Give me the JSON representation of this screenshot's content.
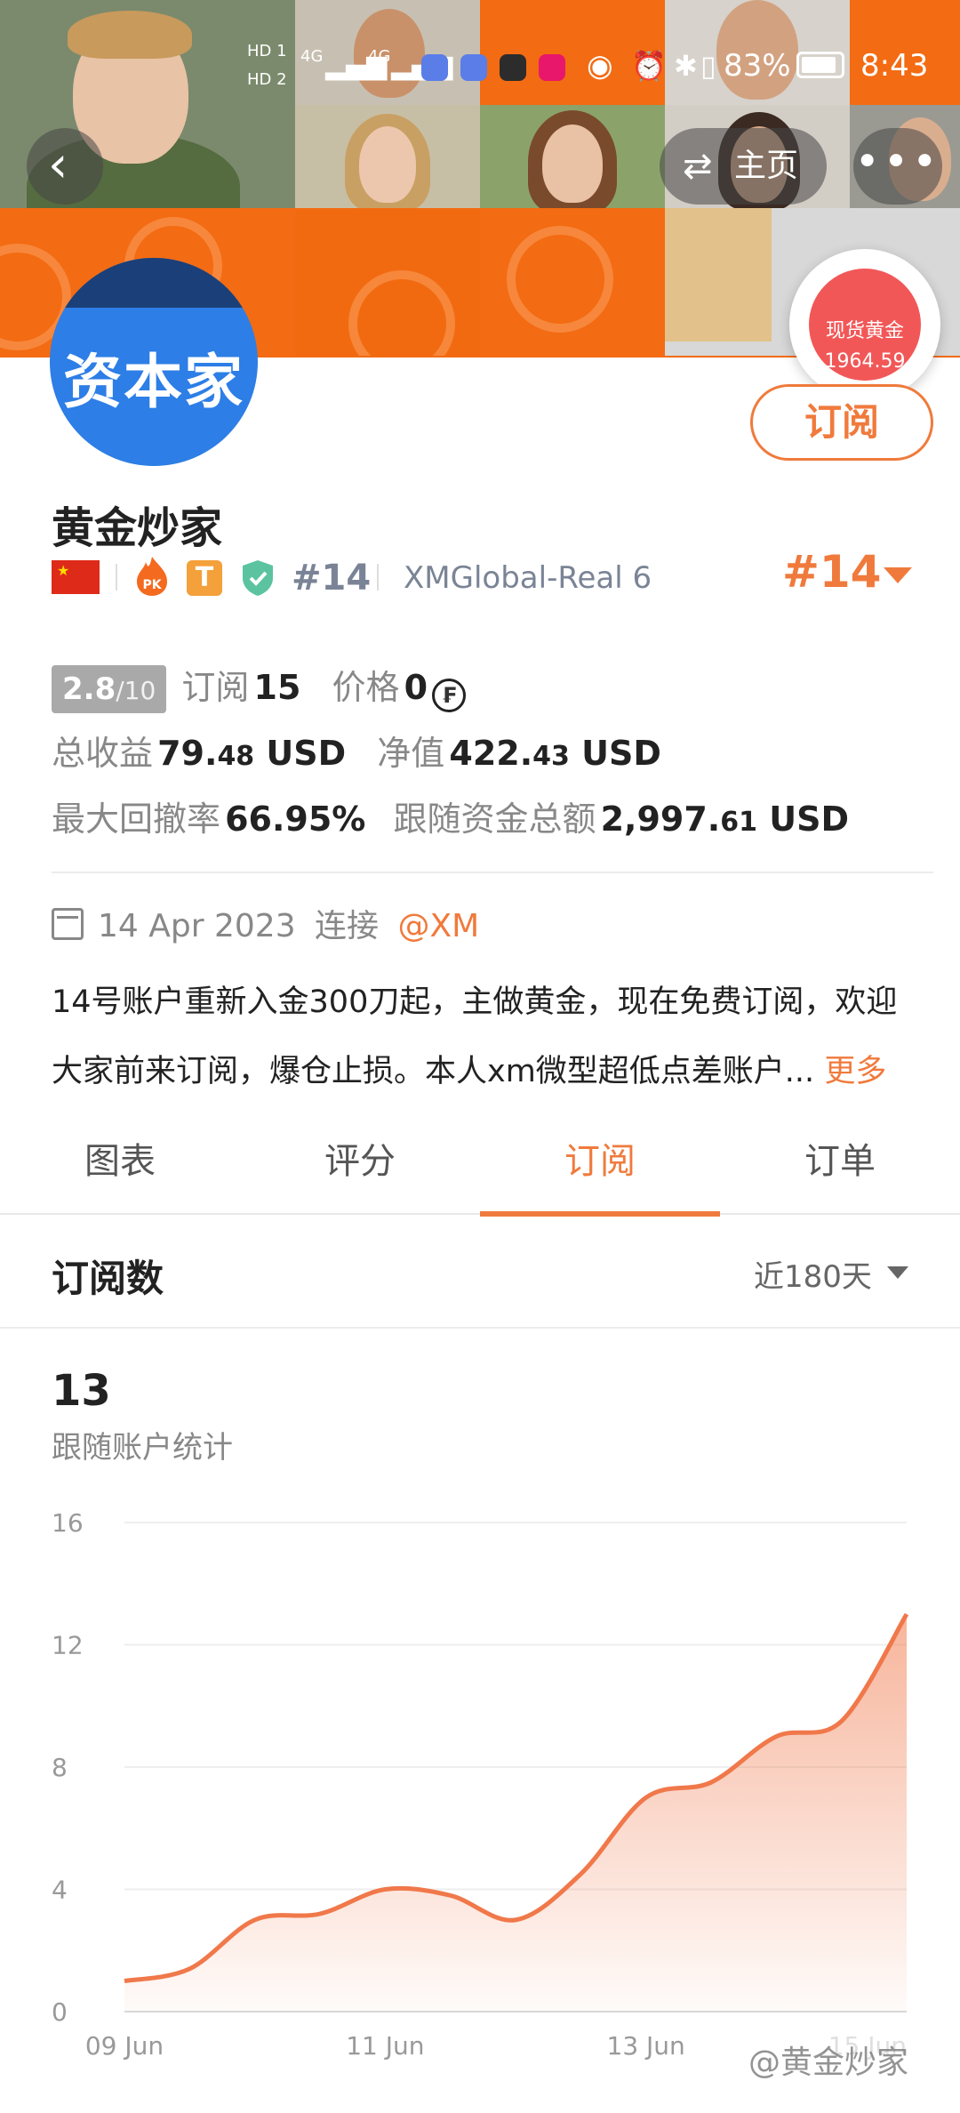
{
  "status_bar": {
    "signal_labels": [
      "HD 1",
      "HD 2"
    ],
    "network": "4G",
    "battery": "83%",
    "time": "8:43"
  },
  "nav": {
    "home_label": "主页",
    "home_icon": "swap-arrows-icon",
    "back_icon": "chevron-left-icon",
    "more_icon": "ellipsis-icon"
  },
  "floating_gold": {
    "label": "现货黄金",
    "price": "1964.59"
  },
  "profile": {
    "avatar_text": "资本家",
    "name": "黄金炒家",
    "subscribe_label": "订阅",
    "rank_badge": "#14",
    "account": "XMGlobal-Real 6",
    "rank_right": "#14",
    "t_badge": "T",
    "pk_badge": "PK"
  },
  "stats": {
    "score": "2.8",
    "score_max": "/10",
    "subscribe_label": "订阅",
    "subscribe_count": "15",
    "price_label": "价格",
    "price_value": "0",
    "coin_symbol": "₣",
    "total_profit_label": "总收益",
    "total_profit_int": "79.",
    "total_profit_dec": "48",
    "total_profit_unit": " USD",
    "equity_label": "净值",
    "equity_int": "422.",
    "equity_dec": "43",
    "equity_unit": " USD",
    "drawdown_label": "最大回撤率",
    "drawdown_value": "66.95%",
    "follow_label": "跟随资金总额",
    "follow_int": "2,997.",
    "follow_dec": "61",
    "follow_unit": " USD"
  },
  "connection": {
    "date": "14 Apr 2023",
    "connect_label": "连接",
    "mention": "@XM"
  },
  "description": {
    "line1": "14号账户重新入金300刀起，主做黄金，现在免费订阅，欢迎",
    "line2": "大家前来订阅，爆仓止损。本人xm微型超低点差账户...",
    "more": "更多"
  },
  "tabs": [
    "图表",
    "评分",
    "订阅",
    "订单"
  ],
  "active_tab": 2,
  "section": {
    "title": "订阅数",
    "range": "近180天"
  },
  "summary": {
    "value": "13",
    "label": "跟随账户统计"
  },
  "chart_data": {
    "type": "area",
    "x": [
      "09 Jun",
      "09.5 Jun",
      "10 Jun",
      "10.5 Jun",
      "11 Jun",
      "11.5 Jun",
      "12 Jun",
      "12.5 Jun",
      "13 Jun",
      "13.5 Jun",
      "14 Jun",
      "14.5 Jun",
      "15 Jun"
    ],
    "tick_labels": [
      "09 Jun",
      "11 Jun",
      "13 Jun",
      "15 Jun"
    ],
    "values": [
      1,
      1.4,
      3,
      3.2,
      4,
      3.8,
      3,
      4.5,
      7,
      7.5,
      9,
      9.5,
      13
    ],
    "ylim": [
      0,
      16
    ],
    "yticks": [
      0,
      4,
      8,
      12,
      16
    ],
    "color": "#f0784a",
    "grid": true
  },
  "watermark": "@黄金炒家"
}
